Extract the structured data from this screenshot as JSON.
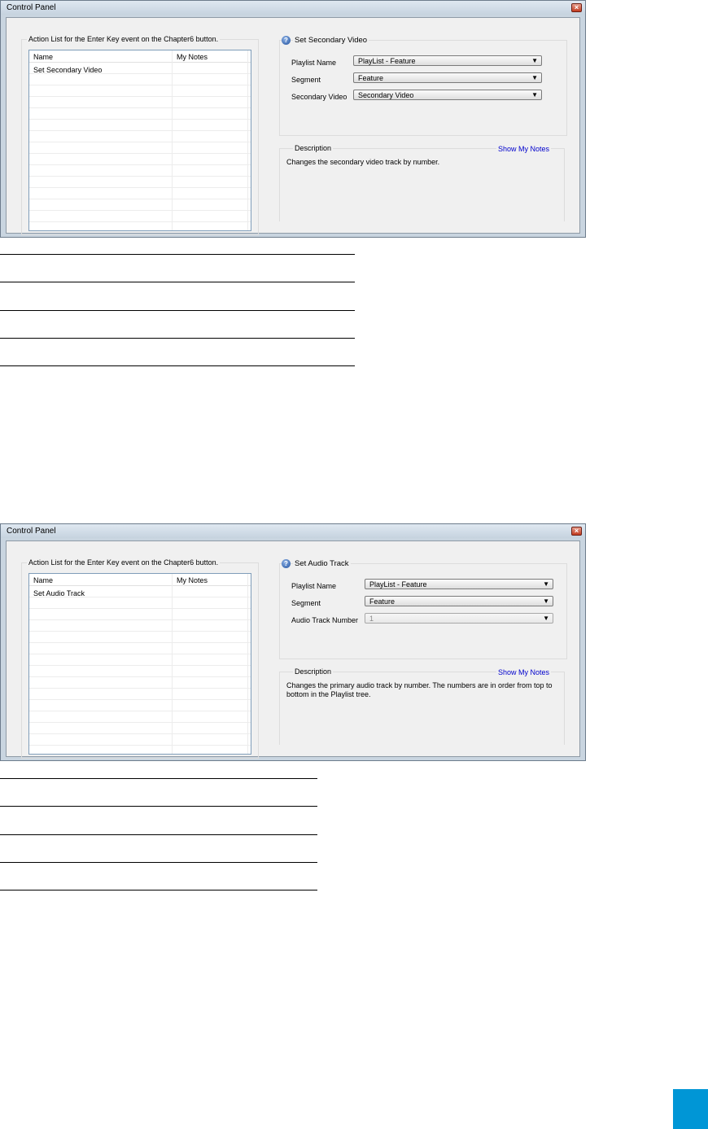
{
  "windows": [
    {
      "title": "Control Panel",
      "close_label": "×",
      "action_list_legend": "Action List for the Enter Key event on the Chapter6 button.",
      "list_headers": {
        "name": "Name",
        "notes": "My Notes"
      },
      "list_items": [
        {
          "name": "Set Secondary Video",
          "notes": ""
        }
      ],
      "help_icon_glyph": "?",
      "action_title": "Set Secondary Video",
      "fields": [
        {
          "label": "Playlist Name",
          "value": "PlayList - Feature"
        },
        {
          "label": "Segment",
          "value": "Feature"
        },
        {
          "label": "Secondary Video",
          "value": "Secondary Video"
        }
      ],
      "description_legend": "Description",
      "show_notes_link": "Show My Notes",
      "description": "Changes the secondary video track by number."
    },
    {
      "title": "Control Panel",
      "close_label": "×",
      "action_list_legend": "Action List for the Enter Key event on the Chapter6 button.",
      "list_headers": {
        "name": "Name",
        "notes": "My Notes"
      },
      "list_items": [
        {
          "name": "Set Audio Track",
          "notes": ""
        }
      ],
      "help_icon_glyph": "?",
      "action_title": "Set Audio Track",
      "fields": [
        {
          "label": "Playlist Name",
          "value": "PlayList - Feature"
        },
        {
          "label": "Segment",
          "value": "Feature"
        },
        {
          "label": "Audio Track Number",
          "value": "1",
          "disabled": true
        }
      ],
      "description_legend": "Description",
      "show_notes_link": "Show My Notes",
      "description": "Changes the primary audio track by number.  The numbers are in order from top to bottom in the Playlist tree."
    }
  ],
  "icons": {
    "help": "help-icon",
    "close": "close-icon",
    "dropdown": "chevron-down-icon"
  },
  "dropdown_arrow": "▼",
  "colors": {
    "accent_tab": "#0096d6",
    "link": "#0000cc",
    "close_button": "#c33a1e"
  }
}
